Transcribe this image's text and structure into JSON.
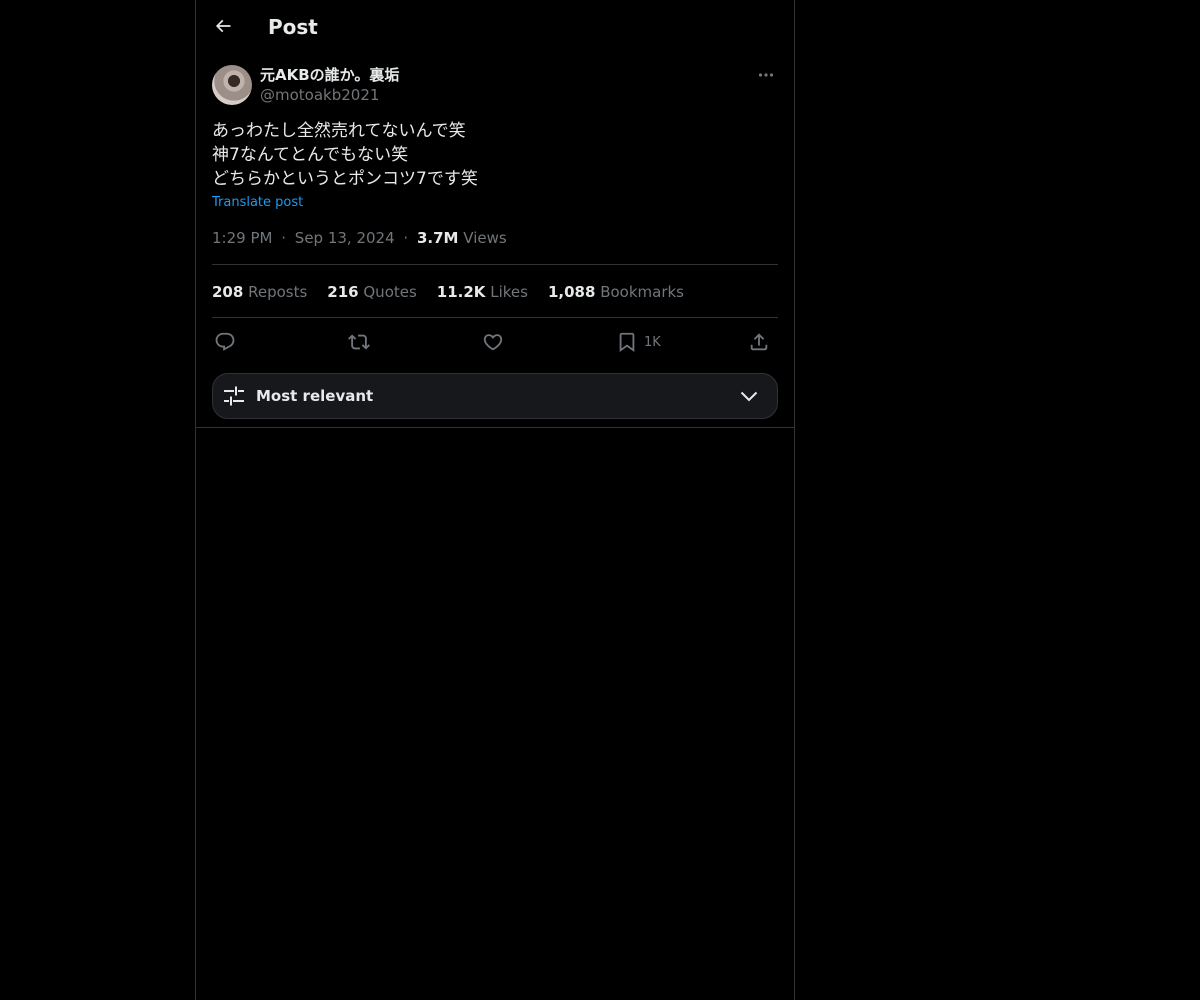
{
  "header": {
    "title": "Post",
    "back_icon": "arrow-left-icon"
  },
  "author": {
    "display_name": "元AKBの誰か。裏垢",
    "handle": "@motoakb2021",
    "more_icon": "ellipsis-icon"
  },
  "post": {
    "text": "あっわたし全然売れてないんで笑\n神7なんてとんでもない笑\nどちらかというとポンコツ7です笑",
    "translate_label": "Translate post",
    "time": "1:29 PM",
    "date": "Sep 13, 2024",
    "separator": "·",
    "views_count": "3.7M",
    "views_label": "Views"
  },
  "stats": [
    {
      "count": "208",
      "label": "Reposts"
    },
    {
      "count": "216",
      "label": "Quotes"
    },
    {
      "count": "11.2K",
      "label": "Likes"
    },
    {
      "count": "1,088",
      "label": "Bookmarks"
    }
  ],
  "actions": {
    "reply_icon": "reply-icon",
    "repost_icon": "repost-icon",
    "like_icon": "heart-icon",
    "bookmark_icon": "bookmark-icon",
    "bookmark_count": "1K",
    "share_icon": "share-icon"
  },
  "sort": {
    "label": "Most relevant",
    "icon": "sliders-icon",
    "chevron": "chevron-down-icon"
  },
  "colors": {
    "background": "#000000",
    "text": "#e7e9ea",
    "secondary_text": "#71767b",
    "link": "#1d9bf0",
    "border": "#2f3336",
    "sort_bar_bg": "#16181c"
  }
}
